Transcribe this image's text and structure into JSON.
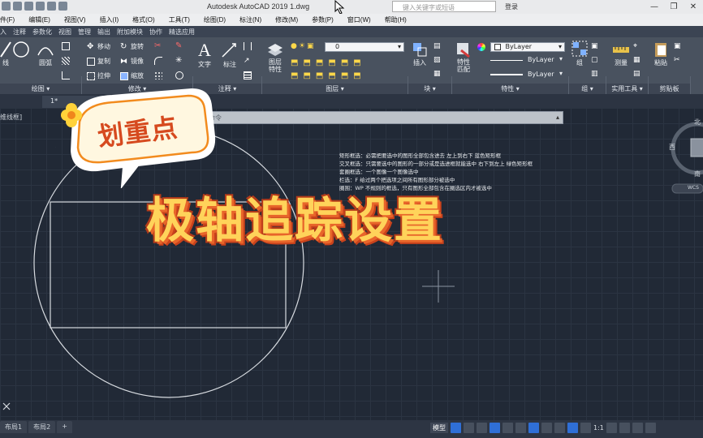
{
  "titlebar": {
    "app_title": "Autodesk AutoCAD 2019    1.dwg",
    "search_placeholder": "键入关键字或短语",
    "user_label": "登录"
  },
  "menubar": {
    "items": [
      "件(F)",
      "编辑(E)",
      "视图(V)",
      "插入(I)",
      "格式(O)",
      "工具(T)",
      "绘图(D)",
      "标注(N)",
      "修改(M)",
      "参数(P)",
      "窗口(W)",
      "帮助(H)"
    ]
  },
  "ribbon_tabs": [
    "入",
    "注释",
    "参数化",
    "视图",
    "管理",
    "输出",
    "附加模块",
    "协作",
    "精选应用"
  ],
  "ribbon": {
    "draw_tools": [
      "线",
      "圆",
      "圆弧"
    ],
    "modify_tools": [
      "移动",
      "旋转",
      "复制",
      "镜像",
      "拉伸",
      "缩放"
    ],
    "annotation_tools": [
      "文字",
      "标注"
    ],
    "layer_value": "0",
    "layer_tools": [
      "图层特性"
    ],
    "block_tools": [
      "插入"
    ],
    "properties_tools": [
      "特性匹配"
    ],
    "bylayer_1": "ByLayer",
    "bylayer_2": "ByLayer",
    "bylayer_3": "ByLayer",
    "group_label": "组",
    "utilities_label": "测量",
    "clipboard_label": "粘贴",
    "panel_footers": [
      "绘图",
      "修改",
      "注释",
      "图层",
      "块",
      "特性",
      "组",
      "实用工具",
      "剪贴板"
    ]
  },
  "doc_tab": "1*",
  "canvas": {
    "view_label": "维线框]",
    "command_placeholder": "键入命令",
    "notes": [
      "矩形框选：必需把要选中的图形全部包含进去    左上到右下    蓝色矩形框",
      "交叉框选：只需要选中的图形的一部分或是选进框就能选中    右下到左上    绿色矩形框",
      "套圈框选：一个图像一个图像选中",
      "栏选：F 给过两个把选项之间所有图形部分被选中",
      "圈围：WP 不规则的框选，只有图形全部包含在圈选区内才被选中"
    ]
  },
  "compass": {
    "north": "北",
    "west": "西",
    "south": "南",
    "wcs": "WCS"
  },
  "sticker": {
    "tag_text": "划重点"
  },
  "headline": "极轴追踪设置",
  "status": {
    "layout_tabs": [
      "布局1",
      "布局2",
      "+"
    ],
    "model_label": "模型",
    "scale_label": "1:1"
  },
  "colors": {
    "canvas_bg": "#212936",
    "headline_fill": "#ffd35a",
    "headline_shadow": "#c9421c",
    "accent_blue": "#2f6fd6"
  }
}
